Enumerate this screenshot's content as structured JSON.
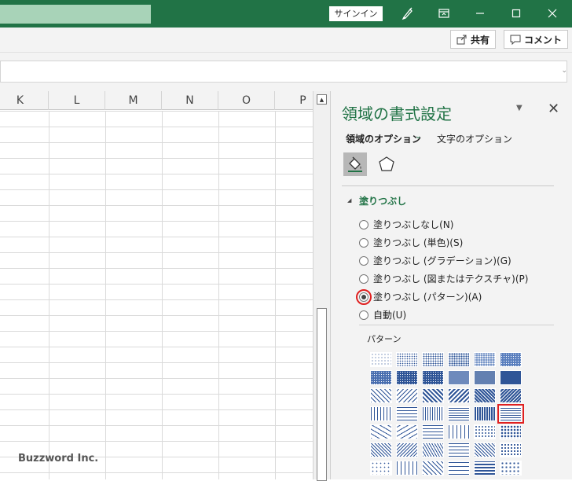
{
  "titlebar": {
    "signin_label": "サインイン",
    "icons": [
      "pen-icon",
      "ribbon-display-icon",
      "minimize-icon",
      "restore-icon",
      "close-icon"
    ]
  },
  "ribbon": {
    "share_label": "共有",
    "comment_label": "コメント"
  },
  "sheet": {
    "columns": [
      "K",
      "L",
      "M",
      "N",
      "O",
      "P"
    ]
  },
  "watermark": "Buzzword Inc.",
  "pane": {
    "title": "領域の書式設定",
    "tab_area": "領域のオプション",
    "tab_text": "文字のオプション",
    "section_fill": "塗りつぶし",
    "fill_options": [
      "塗りつぶしなし(N)",
      "塗りつぶし (単色)(S)",
      "塗りつぶし (グラデーション)(G)",
      "塗りつぶし (図またはテクスチャ)(P)",
      "塗りつぶし (パターン)(A)",
      "自動(U)"
    ],
    "selected_option": 4,
    "pattern_label": "パターン",
    "accent_color": "#217346",
    "pattern_color": "#2f5597",
    "highlight_color": "#e02020"
  }
}
